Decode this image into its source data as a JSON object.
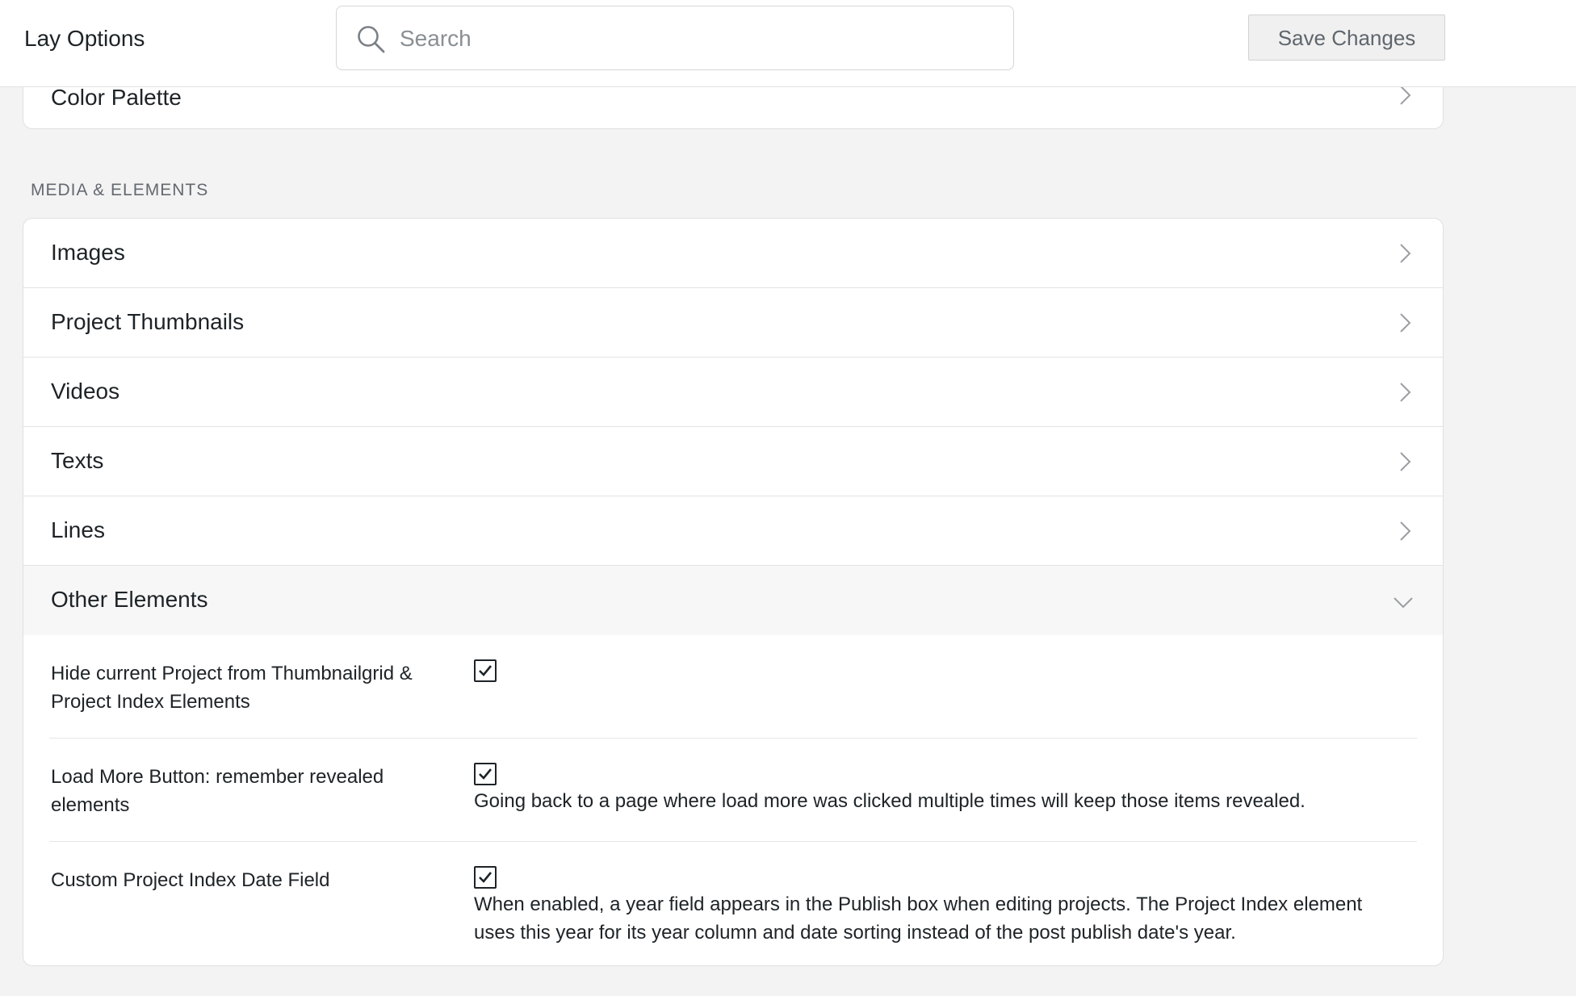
{
  "header": {
    "title": "Lay Options",
    "search_placeholder": "Search",
    "save_label": "Save Changes"
  },
  "top_panel": {
    "item_label": "Color Palette"
  },
  "section": {
    "label": "MEDIA & ELEMENTS",
    "items": [
      {
        "label": "Images"
      },
      {
        "label": "Project Thumbnails"
      },
      {
        "label": "Videos"
      },
      {
        "label": "Texts"
      },
      {
        "label": "Lines"
      },
      {
        "label": "Other Elements"
      }
    ]
  },
  "other_elements": {
    "options": [
      {
        "label": "Hide current Project from Thumbnailgrid & Project Index Elements",
        "checked": true,
        "description": ""
      },
      {
        "label": "Load More Button: remember revealed elements",
        "checked": true,
        "description": "Going back to a page where load more was clicked multiple times will keep those items revealed."
      },
      {
        "label": "Custom Project Index Date Field",
        "checked": true,
        "description": "When enabled, a year field appears in the Publish box when editing projects. The Project Index element uses this year for its year column and date sorting instead of the post publish date's year."
      }
    ]
  },
  "icons": {
    "search": "search-icon",
    "chevron_right": "chevron-right-icon",
    "chevron_down": "chevron-down-icon",
    "checkmark": "checkmark-icon"
  }
}
